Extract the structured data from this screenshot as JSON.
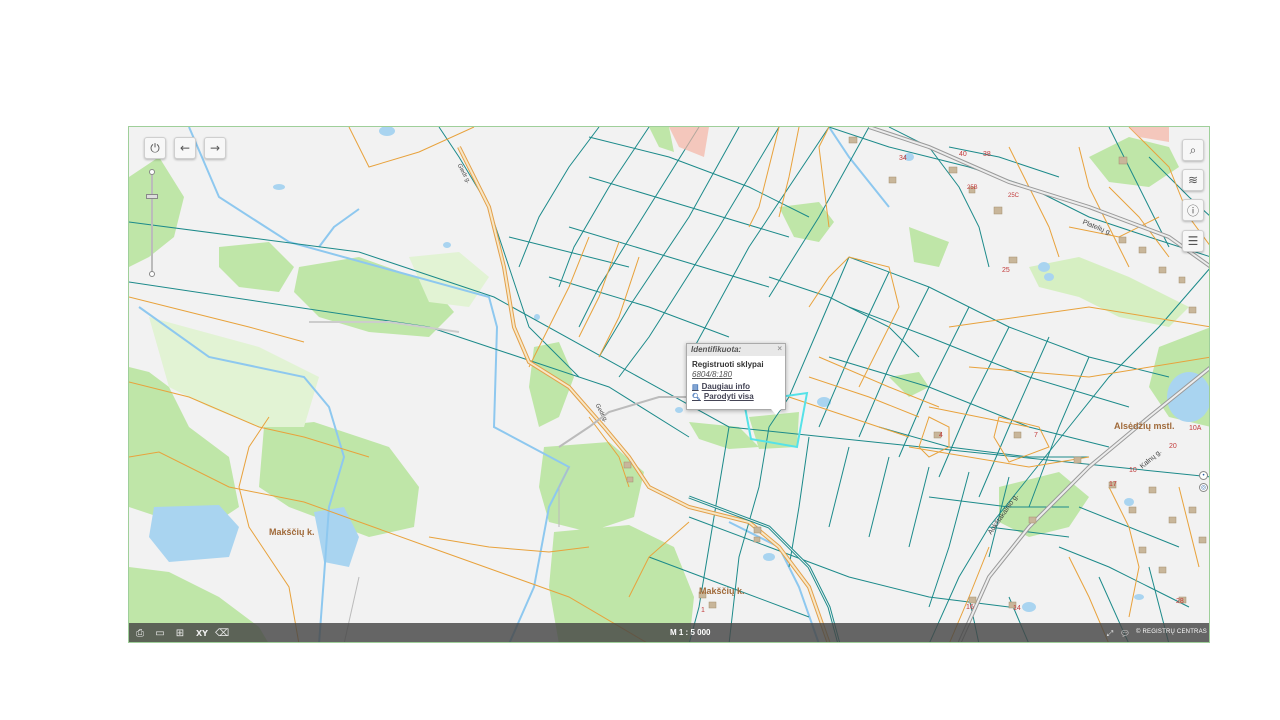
{
  "map": {
    "scale_text": "M 1 : 5 000",
    "brand": "REGISTRŲ CENTRAS",
    "place_labels": {
      "maksciu_left": "Makščių k.",
      "maksciu_bottom": "Makščių k.",
      "alsedziu": "Alsėdžių mstl."
    },
    "road_labels": {
      "plateliu": "Platelių g.",
      "kalnu": "Kalnų g.",
      "aukstakalnio": "Aukštakalnio g.",
      "road_upper": "Giedr g.",
      "road_mid": "Gedr g."
    },
    "house_numbers": [
      "34",
      "38",
      "40",
      "25B",
      "25C",
      "25",
      "17",
      "4",
      "20",
      "10",
      "10A",
      "14",
      "16",
      "28",
      "7",
      "1",
      "2",
      "3",
      "5",
      "12",
      "8"
    ],
    "zoom_level": 0.76
  },
  "controls": {
    "power_icon": "⏻",
    "back_icon": "←",
    "forward_icon": "→",
    "search_icon": "⌕",
    "layers_icon": "≋",
    "info_icon": "ⓘ",
    "legend_icon": "☰"
  },
  "popup": {
    "header": "Identifikuota:",
    "close": "×",
    "title": "Registruoti sklypai",
    "parcel_id": "6804/8:180",
    "more_info": "Daugiau info",
    "show_all": "Parodyti visa"
  },
  "bottom_bar": {
    "print_icon": "⎙",
    "measure_icon": "▭",
    "add_icon": "⊞",
    "xy_label": "XY",
    "eraser_icon": "⌫"
  }
}
